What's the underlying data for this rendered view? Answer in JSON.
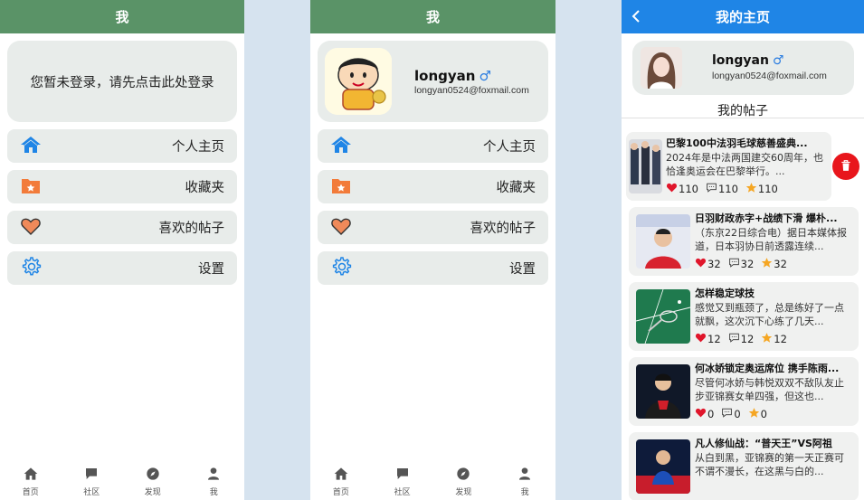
{
  "screen_guest": {
    "header_title": "我",
    "login_prompt": "您暂未登录，请先点击此处登录",
    "menu": [
      "个人主页",
      "收藏夹",
      "喜欢的帖子",
      "设置"
    ],
    "tabs": [
      "首页",
      "社区",
      "发现",
      "我"
    ]
  },
  "screen_logged_in": {
    "header_title": "我",
    "username": "longyan",
    "gender_symbol": "♂",
    "email": "longyan0524@foxmail.com",
    "menu": [
      "个人主页",
      "收藏夹",
      "喜欢的帖子",
      "设置"
    ],
    "tabs": [
      "首页",
      "社区",
      "发现",
      "我"
    ]
  },
  "screen_homepage": {
    "header_title": "我的主页",
    "username": "longyan",
    "gender_symbol": "♂",
    "email": "longyan0524@foxmail.com",
    "section_title": "我的帖子",
    "posts": [
      {
        "title": "巴黎100中法羽毛球慈善盛典...",
        "body": "2024年是中法两国建交60周年，也恰逢奥运会在巴黎举行。...",
        "likes": "110",
        "comments": "110",
        "favorites": "110"
      },
      {
        "title": "日羽财政赤字+战绩下滑 爆朴...",
        "body": "（东京22日综合电）据日本媒体报道，日本羽协日前透露连续...",
        "likes": "32",
        "comments": "32",
        "favorites": "32"
      },
      {
        "title": "怎样稳定球技",
        "body": "感觉又到瓶颈了，总是练好了一点就飘，这次沉下心练了几天...",
        "likes": "12",
        "comments": "12",
        "favorites": "12"
      },
      {
        "title": "何冰娇锁定奥运席位 携手陈雨...",
        "body": "尽管何冰娇与韩悦双双不敌队友止步亚锦赛女单四强，但这也...",
        "likes": "0",
        "comments": "0",
        "favorites": "0"
      },
      {
        "title": "凡人修仙战：“普天王”VS阿祖",
        "body": "从白到黑，亚锦赛的第一天正赛可不谓不漫长，在这黑与白的...",
        "likes": "",
        "comments": "",
        "favorites": ""
      }
    ]
  },
  "colors": {
    "header_green": "#5a9367",
    "header_blue": "#1f85e6",
    "card_bg": "#e8ecea",
    "delete_red": "#e8161c",
    "heart": "#e0162b",
    "star": "#f5a623"
  }
}
